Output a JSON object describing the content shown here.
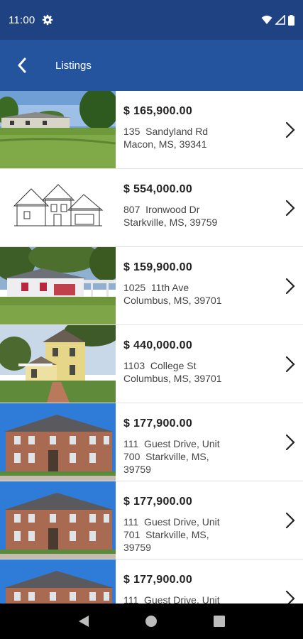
{
  "status_bar": {
    "time": "11:00",
    "icons": [
      "gear-icon",
      "wifi-icon",
      "signal-icon",
      "battery-icon"
    ]
  },
  "app_bar": {
    "title": "Listings",
    "back_icon": "chevron-left-icon"
  },
  "listings": [
    {
      "price": "$ 165,900.00",
      "address": "135  Sandyland Rd\nMacon, MS, 39341",
      "photo": "ranch-house-photo"
    },
    {
      "price": "$ 554,000.00",
      "address": "807  Ironwood Dr\nStarkville, MS, 39759",
      "photo": "house-sketch"
    },
    {
      "price": "$ 159,900.00",
      "address": "1025  11th Ave\nColumbus, MS, 39701",
      "photo": "white-house-photo"
    },
    {
      "price": "$ 440,000.00",
      "address": "1103  College St\nColumbus, MS, 39701",
      "photo": "victorian-house-photo"
    },
    {
      "price": "$ 177,900.00",
      "address": "111  Guest Drive, Unit\n700  Starkville, MS,\n39759",
      "photo": "brick-townhouse-photo"
    },
    {
      "price": "$ 177,900.00",
      "address": "111  Guest Drive, Unit\n701  Starkville, MS,\n39759",
      "photo": "brick-townhouse-photo"
    },
    {
      "price": "$ 177,900.00",
      "address": "111  Guest Drive, Unit",
      "photo": "brick-townhouse-photo"
    }
  ],
  "colors": {
    "status_bar": "#1e4282",
    "app_bar": "#24549e",
    "nav_bar": "#000000"
  },
  "nav_bar": {
    "buttons": [
      "back-triangle-icon",
      "home-circle-icon",
      "recents-square-icon"
    ]
  }
}
